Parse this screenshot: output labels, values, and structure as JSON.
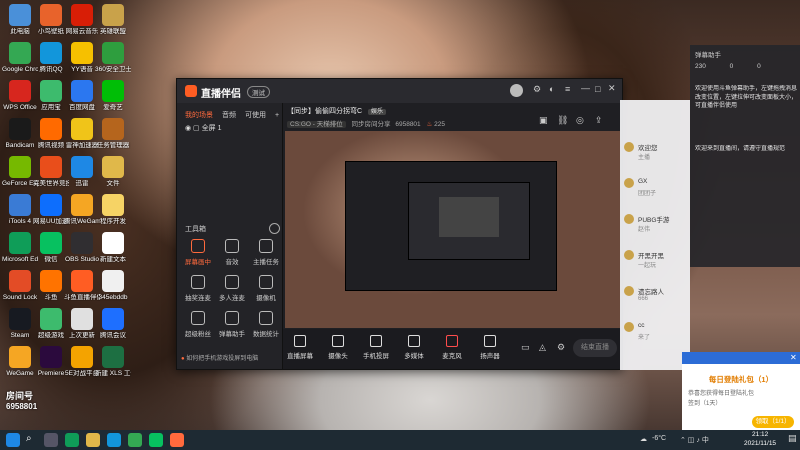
{
  "desktop": {
    "icons": [
      {
        "label": "此电脑",
        "color": "#4a90d9"
      },
      {
        "label": "小鸟壁纸",
        "color": "#e8632b"
      },
      {
        "label": "网易云音乐",
        "color": "#d81e06"
      },
      {
        "label": "英雄联盟",
        "color": "#c9a24a"
      },
      {
        "label": "Google Chrome",
        "color": "#34a853"
      },
      {
        "label": "腾讯QQ",
        "color": "#1296db"
      },
      {
        "label": "YY语音",
        "color": "#f6c000"
      },
      {
        "label": "360安全卫士",
        "color": "#2e9e3e"
      },
      {
        "label": "WPS Office",
        "color": "#d7261e"
      },
      {
        "label": "应用宝",
        "color": "#3dbb6d"
      },
      {
        "label": "百度网盘",
        "color": "#2b77f0"
      },
      {
        "label": "爱奇艺",
        "color": "#00be06"
      },
      {
        "label": "Bandicam",
        "color": "#1a1a1a"
      },
      {
        "label": "腾讯视频",
        "color": "#ff6a00"
      },
      {
        "label": "雷神加速器",
        "color": "#f0c419"
      },
      {
        "label": "任务管理器",
        "color": "#b5651d"
      },
      {
        "label": "GeForce Experience",
        "color": "#76b900"
      },
      {
        "label": "完美世界竞技平台",
        "color": "#e94e1b"
      },
      {
        "label": "迅雷",
        "color": "#1e88e5"
      },
      {
        "label": "文件",
        "color": "#e0b84a"
      },
      {
        "label": "iTools 4",
        "color": "#3a7bd5"
      },
      {
        "label": "网易UU加速器",
        "color": "#0d6efd"
      },
      {
        "label": "腾讯WeGame",
        "color": "#f5a623"
      },
      {
        "label": "程序开发",
        "color": "#f6d365"
      },
      {
        "label": "Microsoft Edge",
        "color": "#0f9d58"
      },
      {
        "label": "微信",
        "color": "#07c160"
      },
      {
        "label": "OBS Studio",
        "color": "#302e31"
      },
      {
        "label": "新建文本",
        "color": "#ffffff"
      },
      {
        "label": "Sound Lock",
        "color": "#e34c26"
      },
      {
        "label": "斗鱼",
        "color": "#ff7300"
      },
      {
        "label": "斗鱼直播伴侣",
        "color": "#ff5d23"
      },
      {
        "label": "345ebddb",
        "color": "#f0f0f0"
      },
      {
        "label": "Steam",
        "color": "#171a21"
      },
      {
        "label": "超级游戏",
        "color": "#3dbb6d"
      },
      {
        "label": "上次更新",
        "color": "#e0e0e0"
      },
      {
        "label": "腾讯会议",
        "color": "#1e6fff"
      },
      {
        "label": "WeGame",
        "color": "#f5a623"
      },
      {
        "label": "Premiere",
        "color": "#2b0a3d"
      },
      {
        "label": "5E对战平台",
        "color": "#f4a300"
      },
      {
        "label": "新建 XLS 工作表",
        "color": "#1d6f42"
      }
    ],
    "watermark_room_id": "6958801",
    "watermark_room_label": "房间号"
  },
  "app": {
    "brand": "直播伴侣",
    "version_badge": "测试",
    "stream_title": "【同步】偷偷四分拐弯C",
    "stream_tag": "娱乐",
    "category": "CS:GO - 天梯排位",
    "room_label": "同步房间分享",
    "room_id": "6958801",
    "viewers": "225",
    "side_tabs": [
      "我的场景",
      "音频",
      "可使用",
      "+"
    ],
    "scene_item": "全屏 1",
    "tools_title": "工具箱",
    "tools": [
      {
        "label": "屏幕画中"
      },
      {
        "label": "音效"
      },
      {
        "label": "主播任务"
      },
      {
        "label": "抽奖连麦"
      },
      {
        "label": "多人连麦"
      },
      {
        "label": "摄像机"
      },
      {
        "label": "超级粉丝"
      },
      {
        "label": "弹幕助手"
      },
      {
        "label": "数据统计"
      }
    ],
    "footer_notice": "如何把手机游戏投屏到电脑",
    "bottom_buttons": [
      {
        "label": "直播屏幕"
      },
      {
        "label": "摄像头"
      },
      {
        "label": "手机投屏"
      },
      {
        "label": "多媒体"
      },
      {
        "label": "麦克风"
      },
      {
        "label": "扬声器"
      }
    ],
    "start_button": "结束直播"
  },
  "chat": {
    "items": [
      {
        "name": "欢迎您",
        "msg": "主播"
      },
      {
        "name": "GX",
        "msg": "团团子"
      },
      {
        "name": "PUBG手游",
        "msg": "赵伟"
      },
      {
        "name": "开黑开黑",
        "msg": "一起玩"
      },
      {
        "name": "遗忘路人",
        "msg": "666"
      },
      {
        "name": "cc",
        "msg": "来了"
      }
    ]
  },
  "info": {
    "header": "弹幕助手",
    "welcome": "欢迎使用斗鱼弹幕助手，左键拖拽消息改变位置，左键拉伸可改变面板大小，可直播伴侣使用",
    "note": "欢迎来到直播间，请遵守直播规范",
    "stats": [
      "230",
      "0",
      "0"
    ]
  },
  "popup": {
    "title": "每日登陆礼包（1）",
    "line1": "恭喜您获得每日登陆礼包",
    "line2": "签到（1天）",
    "button": "领取（1/1）"
  },
  "taskbar": {
    "weather": "-6°C",
    "time": "21:12",
    "date": "2021/11/15"
  }
}
